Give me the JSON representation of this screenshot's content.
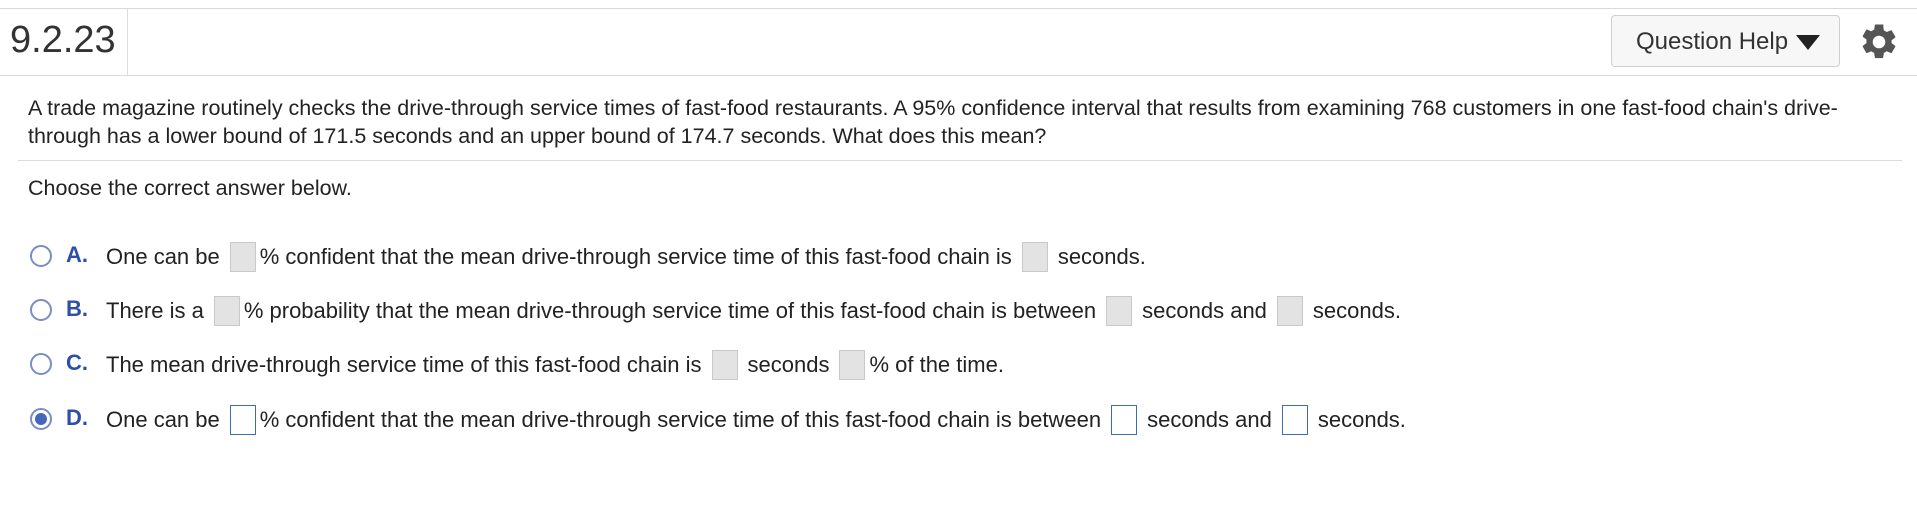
{
  "header": {
    "question_number": "9.2.23",
    "help_button_label": "Question Help"
  },
  "question": {
    "text": "A trade magazine routinely checks the drive-through service times of fast-food restaurants. A 95% confidence interval that results from examining 768 customers in one fast-food chain's drive-through has a lower bound of 171.5 seconds and an upper bound of 174.7 seconds. What does this mean?",
    "instruction": "Choose the correct answer below."
  },
  "options": [
    {
      "letter": "A.",
      "selected": false,
      "parts": [
        "One can be",
        "% confident that the mean drive-through service time of this fast-food chain is",
        "seconds."
      ]
    },
    {
      "letter": "B.",
      "selected": false,
      "parts": [
        "There is a",
        "% probability that the mean drive-through service time of this fast-food chain is between",
        "seconds and",
        "seconds."
      ]
    },
    {
      "letter": "C.",
      "selected": false,
      "parts": [
        "The mean drive-through service time of this fast-food chain is",
        "seconds",
        "% of the time."
      ]
    },
    {
      "letter": "D.",
      "selected": true,
      "parts": [
        "One can be",
        "% confident that the mean drive-through service time of this fast-food chain is between",
        "seconds and",
        "seconds."
      ]
    }
  ],
  "colors": {
    "accent": "#2d4fa8",
    "radio_selected": "#4466bb",
    "blank_inactive": "#e3e3e3",
    "blank_active_border": "#3a6fb5"
  },
  "icons": {
    "help_caret": "caret-down-icon",
    "settings": "gear-icon"
  }
}
